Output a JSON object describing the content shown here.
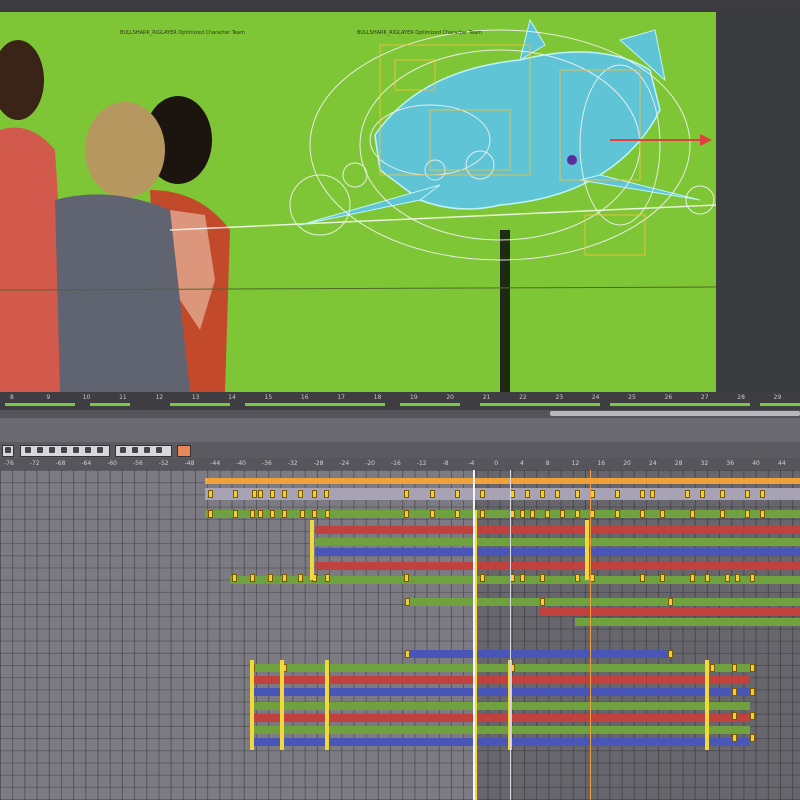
{
  "viewport": {
    "label_left": "BULLSHARK_RIGLAYER Optimized Character Team",
    "label_right": "BULLSHARK_RIGLAYER Optimized Character Team"
  },
  "timeline_ruler": {
    "ticks": [
      "8",
      "9",
      "10",
      "11",
      "12",
      "13",
      "14",
      "15",
      "16",
      "17",
      "18",
      "19",
      "20",
      "21",
      "22",
      "23",
      "24",
      "25",
      "26",
      "27",
      "28",
      "29"
    ]
  },
  "graph_editor": {
    "frame_labels": [
      "-76",
      "-72",
      "-68",
      "-64",
      "-60",
      "-56",
      "-52",
      "-48",
      "-44",
      "-40",
      "-36",
      "-32",
      "-28",
      "-24",
      "-20",
      "-16",
      "-12",
      "-8",
      "-4",
      "0",
      "4",
      "8",
      "12",
      "16",
      "20",
      "24",
      "28",
      "32",
      "36",
      "40",
      "44"
    ],
    "playhead_frame": "8",
    "current_frame_marker": "20"
  },
  "toolbar": {
    "icons": [
      "select-key-icon",
      "move-key-icon",
      "insert-key-icon",
      "lattice-icon",
      "region-icon",
      "tangent-icon",
      "buffer-curve-icon",
      "curve-color-icon"
    ]
  },
  "colors": {
    "greenscreen": "#7fc636",
    "rig_cyan": "#7be0ef",
    "curve_red": "#c0413e",
    "curve_green": "#6fa23e",
    "curve_blue": "#4a55b8",
    "curve_orange": "#f0a23a",
    "key_yellow": "#f2ce3c"
  }
}
